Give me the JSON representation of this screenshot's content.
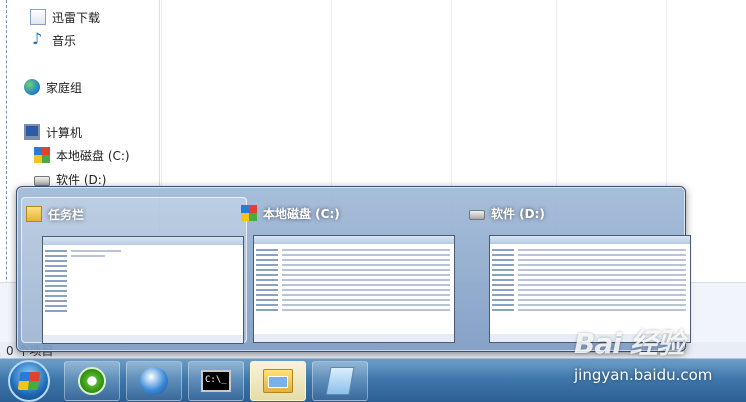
{
  "nav": {
    "items": [
      {
        "label": "迅雷下载",
        "icon": "download-folder-icon"
      },
      {
        "label": "音乐",
        "icon": "music-icon"
      },
      {
        "label": "家庭组",
        "icon": "homegroup-icon"
      },
      {
        "label": "计算机",
        "icon": "computer-icon"
      },
      {
        "label": "本地磁盘 (C:)",
        "icon": "windows-drive-icon"
      },
      {
        "label": "软件 (D:)",
        "icon": "hard-drive-icon"
      }
    ]
  },
  "status": {
    "details_text": "0 个项目"
  },
  "thumbnail_popup": {
    "windows": [
      {
        "title": "任务栏",
        "icon": "folder-icon",
        "active": true
      },
      {
        "title": "本地磁盘 (C:)",
        "icon": "windows-drive-icon",
        "active": false
      },
      {
        "title": "软件 (D:)",
        "icon": "hard-drive-icon",
        "active": false
      }
    ]
  },
  "taskbar": {
    "buttons": [
      {
        "name": "start-button",
        "icon": "windows-logo-icon"
      },
      {
        "name": "browser-green-button",
        "icon": "green-refresh-icon"
      },
      {
        "name": "internet-explorer-button",
        "icon": "globe-icon"
      },
      {
        "name": "command-prompt-button",
        "icon": "cmd-icon",
        "glyph": "C:\\_"
      },
      {
        "name": "explorer-button",
        "icon": "folder-icon",
        "active": true
      },
      {
        "name": "notepad-button",
        "icon": "notepad-icon"
      }
    ]
  },
  "watermark": {
    "brand": "Bai 经验",
    "url": "jingyan.baidu.com"
  },
  "colors": {
    "taskbar": "#3f78ac",
    "popup": "#a0b9d7",
    "accent": "#1b6fc4"
  }
}
